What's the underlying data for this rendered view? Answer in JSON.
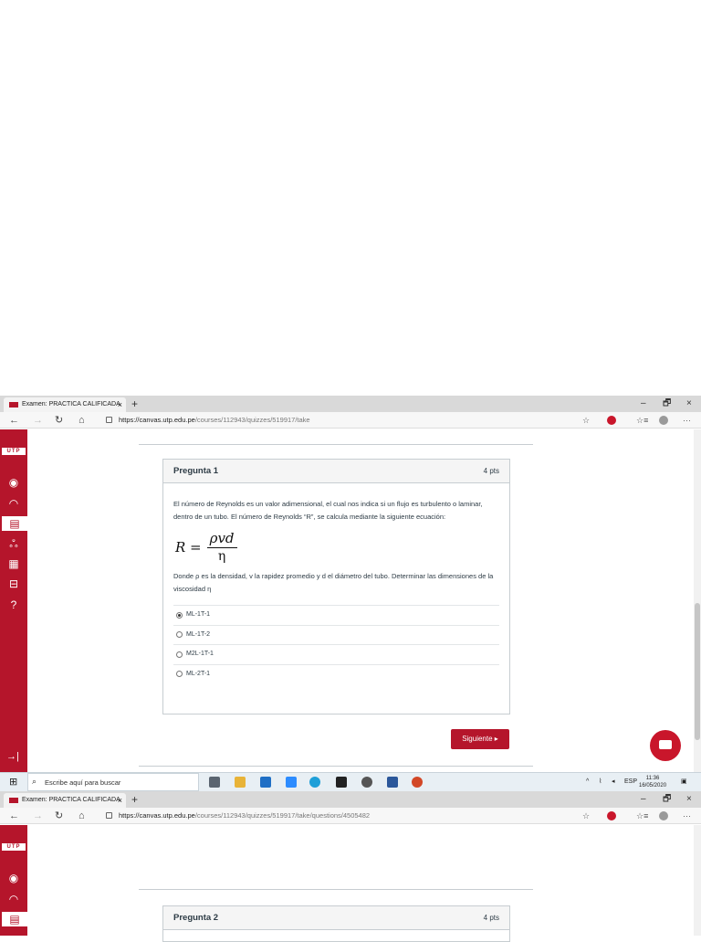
{
  "browser": {
    "tab_title": "Examen: PRACTICA CALIFICADA",
    "tab_close": "×",
    "new_tab": "+",
    "minimize": "–",
    "restore": "🗗",
    "close": "×",
    "url_host_1": "https://canvas.utp.edu.pe",
    "url_path_1": "/courses/112943/quizzes/519917/take",
    "url_host_2": "https://canvas.utp.edu.pe",
    "url_path_2": "/courses/112943/quizzes/519917/take/questions/4505482",
    "back": "←",
    "forward": "→",
    "refresh": "↻",
    "home": "⌂",
    "favorite": "☆",
    "favorites_list": "☆≡",
    "more": "···"
  },
  "sidebar": {
    "logo": "UTP",
    "icons": [
      "account-icon",
      "dashboard-icon",
      "courses-icon",
      "groups-icon",
      "calendar-icon",
      "inbox-icon",
      "help-icon"
    ],
    "collapse": "→|"
  },
  "question1": {
    "title": "Pregunta 1",
    "points": "4 pts",
    "text1": "El número de Reynolds es un valor adimensional, el cual nos indica si un flujo es turbulento o laminar, dentro de un tubo. El número de Reynolds “R”, se calcula mediante la siguiente ecuación:",
    "formula_lhs": "R =",
    "formula_num": "ρvd",
    "formula_den": "η",
    "text2": "Donde ρ es la densidad, v la rapidez promedio y d el diámetro del tubo. Determinar las dimensiones de la viscosidad η",
    "answers": [
      "ML-1T-1",
      "ML-1T-2",
      "M2L-1T-1",
      "ML-2T-1"
    ],
    "selected": 0
  },
  "next_button": "Siguiente ▸",
  "question2": {
    "title": "Pregunta 2",
    "points": "4 pts"
  },
  "taskbar": {
    "search_placeholder": "Escribe aquí para buscar",
    "tray_lang": "ESP",
    "clock_time": "11:36",
    "clock_date": "16/05/2020"
  },
  "colors": {
    "brand": "#b5152b",
    "chat": "#c9162b"
  }
}
